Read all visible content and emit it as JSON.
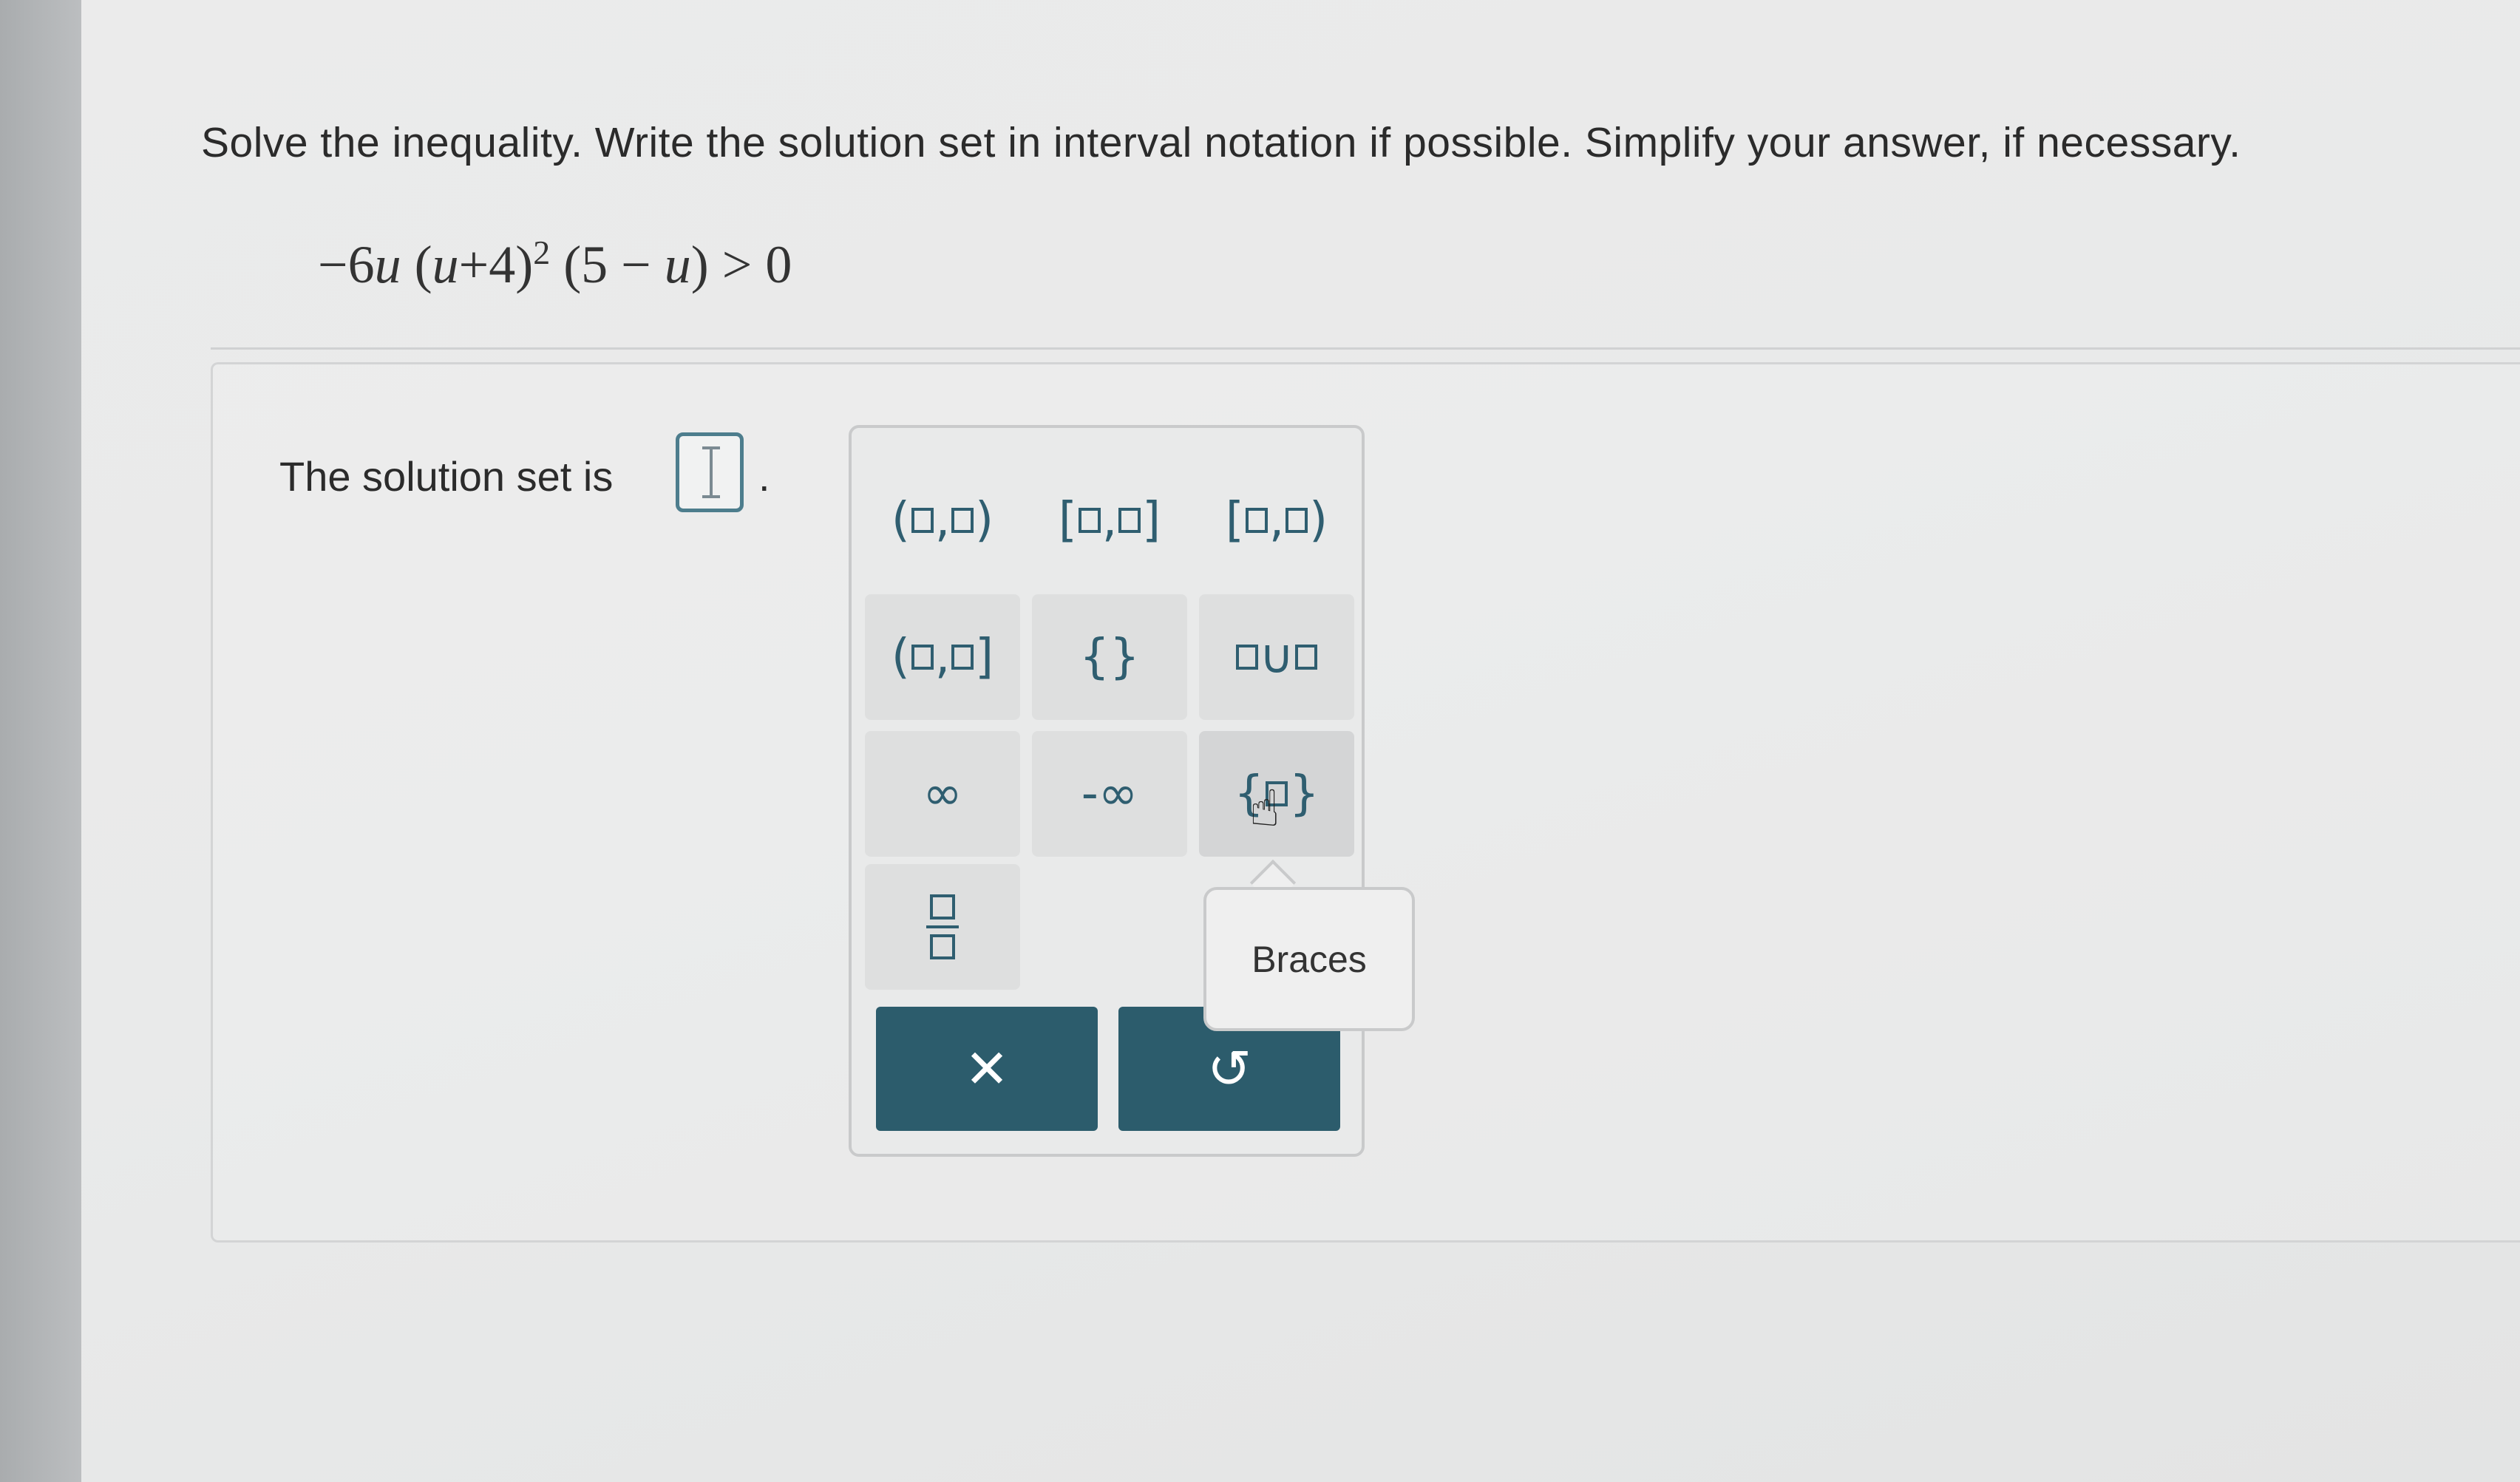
{
  "question": {
    "instruction": "Solve the inequality. Write the solution set in interval notation if possible. Simplify your answer, if necessary.",
    "equation": {
      "part1": "−6",
      "var1": "u",
      "part2": " (",
      "var2": "u",
      "part3": "+4)",
      "exponent": "2",
      "part4": " (5 − ",
      "var3": "u",
      "part5": ") > 0"
    }
  },
  "answer": {
    "prompt": "The solution set is",
    "period": "."
  },
  "palette": {
    "keys": [
      {
        "name": "open-interval-button",
        "left": "(",
        "sep": ",",
        "right": ")"
      },
      {
        "name": "closed-interval-button",
        "left": "[",
        "sep": ",",
        "right": "]"
      },
      {
        "name": "half-open-right-button",
        "left": "[",
        "sep": ",",
        "right": ")"
      },
      {
        "name": "half-open-left-button",
        "left": "(",
        "sep": ",",
        "right": "]"
      },
      {
        "name": "empty-set-button",
        "symbol": "{}"
      },
      {
        "name": "union-button",
        "symbol": "∪"
      },
      {
        "name": "infinity-button",
        "symbol": "∞"
      },
      {
        "name": "negative-infinity-button",
        "symbol": "-∞"
      },
      {
        "name": "braces-button",
        "left": "{",
        "right": "}"
      },
      {
        "name": "fraction-button"
      }
    ],
    "clear_symbol": "✕",
    "undo_symbol": "↺",
    "tooltip": "Braces"
  },
  "icons": {
    "clear": "close-icon",
    "undo": "undo-icon",
    "cursor": "text-cursor-icon",
    "pointer": "hand-pointer-icon"
  },
  "colors": {
    "accent": "#2c5c6c",
    "key_text": "#2f5e70",
    "answer_box_border": "#4d7d8d"
  }
}
